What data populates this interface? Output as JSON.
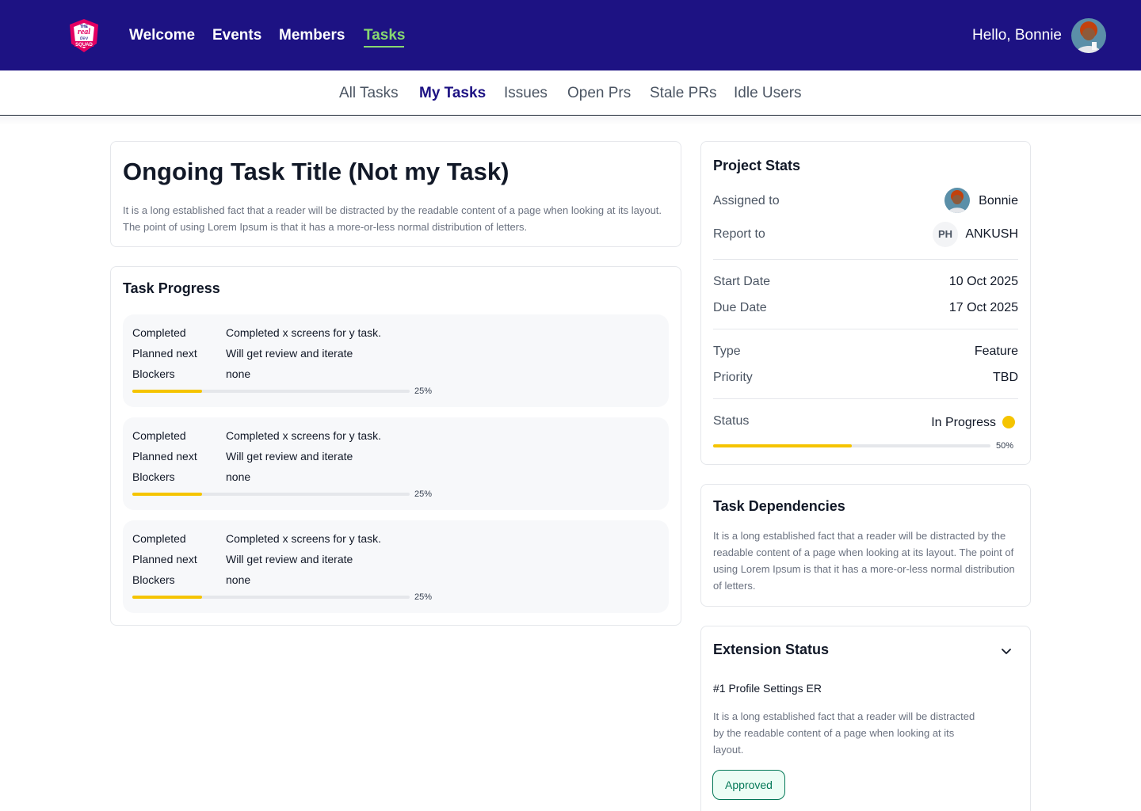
{
  "nav": {
    "links": [
      "Welcome",
      "Events",
      "Members",
      "Tasks"
    ],
    "active": "Tasks",
    "greeting": "Hello, Bonnie",
    "logo_text": [
      "THE",
      "real",
      "dev",
      "SQUAD"
    ]
  },
  "subnav": {
    "links": [
      "All Tasks",
      "My Tasks",
      "Issues",
      "Open Prs",
      "Stale PRs",
      "Idle Users"
    ],
    "active": "My Tasks"
  },
  "task": {
    "title": "Ongoing Task Title (Not my Task)",
    "description": "It is a long established fact that a reader will be distracted by the readable content of a page when looking at its layout. The point of using Lorem Ipsum is that it has a more-or-less normal distribution of letters."
  },
  "progress": {
    "heading": "Task Progress",
    "labels": {
      "completed": "Completed",
      "planned": "Planned next",
      "blockers": "Blockers"
    },
    "entries": [
      {
        "completed": "Completed x screens for y task.",
        "planned": "Will get review and iterate",
        "blockers": "none",
        "percent": 25,
        "percent_label": "25%"
      },
      {
        "completed": "Completed x screens for y task.",
        "planned": "Will get review and iterate",
        "blockers": "none",
        "percent": 25,
        "percent_label": "25%"
      },
      {
        "completed": "Completed x screens for y task.",
        "planned": "Will get review and iterate",
        "blockers": "none",
        "percent": 25,
        "percent_label": "25%"
      }
    ]
  },
  "stats": {
    "heading": "Project Stats",
    "assigned_label": "Assigned to",
    "assigned_value": "Bonnie",
    "report_label": "Report to",
    "report_initials": "PH",
    "report_value": "ANKUSH",
    "start_label": "Start Date",
    "start_value": "10 Oct 2025",
    "due_label": "Due Date",
    "due_value": "17 Oct 2025",
    "type_label": "Type",
    "type_value": "Feature",
    "priority_label": "Priority",
    "priority_value": "TBD",
    "status_label": "Status",
    "status_value": "In Progress",
    "status_color": "#f5c400",
    "progress_percent": 50,
    "progress_label": "50%"
  },
  "dependencies": {
    "heading": "Task Dependencies",
    "description": "It is a long established fact that a reader will be distracted by the readable content of a page when looking at its layout. The point of using Lorem Ipsum is that it has a more-or-less normal distribution of letters."
  },
  "extension": {
    "heading": "Extension Status",
    "item_title": "#1 Profile Settings ER",
    "item_description": "It is a long established fact that a reader will be distracted by the readable content of a page when looking at its layout.",
    "badge": "Approved"
  },
  "colors": {
    "nav_bg": "#1d1283",
    "active_nav": "#87d870",
    "progress_fill": "#f5c400",
    "approved": "#047857"
  }
}
